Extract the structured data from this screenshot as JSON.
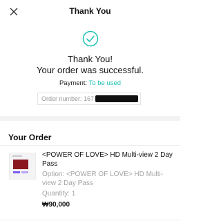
{
  "header": {
    "title": "Thank You",
    "close_icon": "close-icon"
  },
  "confirmation": {
    "icon": "check-circle-icon",
    "line1": "Thank You!",
    "line2": "Your order was successful.",
    "payment_label": "Payment:",
    "payment_status": "To be used",
    "order_number": "Order number: 167"
  },
  "order": {
    "section_title": "Your Order",
    "item": {
      "name": "<POWER OF LOVE> HD Multi-view 2 Day Pass",
      "option": "Option: <POWER OF LOVE> HD Multi-view 2 Day Pass",
      "quantity": "Quantity: 1",
      "price": "₩90,000"
    }
  },
  "colors": {
    "accent": "#20c2b3",
    "text": "#111111",
    "muted": "#a3a3a3"
  }
}
